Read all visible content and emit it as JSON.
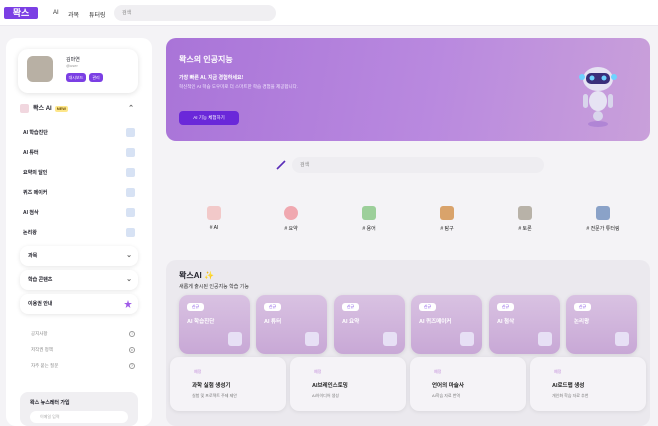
{
  "topbar": {
    "logo": "뫅스",
    "nav": [
      "AI",
      "과목",
      "튜터링"
    ],
    "search_placeholder": "검색"
  },
  "sidebar": {
    "profile": {
      "name": "김마연",
      "id": "@user",
      "dashboard_label": "대시보드",
      "manage_label": "관리"
    },
    "ai_section": {
      "label": "뫅스 AI",
      "badge": "NEW"
    },
    "ai_items": [
      "AI 학습진단",
      "AI 튜터",
      "요약의 달인",
      "퀴즈 메이커",
      "AI 첨삭",
      "논리왕"
    ],
    "groups": [
      "과목",
      "학습 콘텐츠",
      "이용권 안내"
    ],
    "links": [
      "공지사항",
      "저작권 정책",
      "자주 묻는 질문"
    ],
    "newsletter": {
      "title": "뫅스 뉴스레터 가입",
      "placeholder": "이메일 입력"
    }
  },
  "hero": {
    "title": "뫅스의 인공지능",
    "subtitle": "가장 빠른 AI, 지금 경험하세요!",
    "desc": "혁신적인 AI 학습 도우미로 더 스마트한 학습 경험을 제공합니다.",
    "button": "AI 기능 체험하기"
  },
  "main_search": {
    "placeholder": "검색"
  },
  "categories": [
    "# AI",
    "# 요약",
    "# 용어",
    "# 탐구",
    "# 토론",
    "# 전문가 튜터링"
  ],
  "ai_section": {
    "title": "뫅스AI ✨",
    "subtitle": "새롭게 출시된 인공지능 학습 기능",
    "cards": [
      {
        "tag": "신규",
        "name": "AI 학습진단"
      },
      {
        "tag": "신규",
        "name": "AI 튜터"
      },
      {
        "tag": "신규",
        "name": "AI 요약"
      },
      {
        "tag": "신규",
        "name": "AI 퀴즈메이커"
      },
      {
        "tag": "신규",
        "name": "AI 첨삭"
      },
      {
        "tag": "신규",
        "name": "논리왕"
      }
    ],
    "upcoming": [
      {
        "tag": "예정",
        "name": "과학 실험 생성기",
        "desc": "실험 및 프로젝트 주제 제안"
      },
      {
        "tag": "예정",
        "name": "AI브레인스토밍",
        "desc": "AI아이디어 생성"
      },
      {
        "tag": "예정",
        "name": "언어의 마술사",
        "desc": "AI학습 자료 번역"
      },
      {
        "tag": "예정",
        "name": "AI로드맵 생성",
        "desc": "개인화 학습 자료 추천"
      }
    ]
  },
  "colors": {
    "accent": "#7b3fe4",
    "hero_start": "#a974d8",
    "hero_end": "#c9a0da"
  }
}
